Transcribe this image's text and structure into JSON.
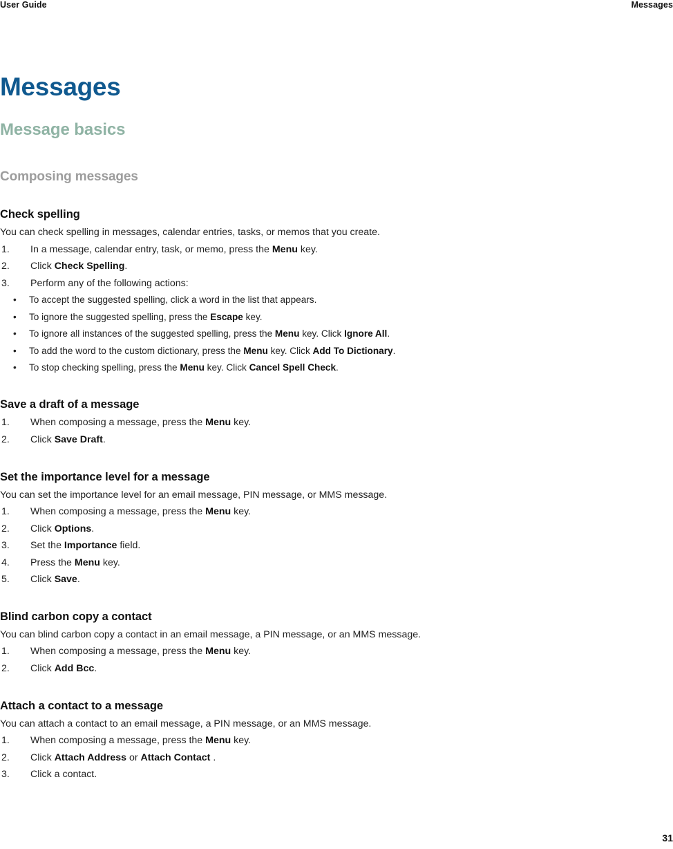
{
  "header": {
    "left": "User Guide",
    "right": "Messages"
  },
  "titles": {
    "h1": "Messages",
    "h2": "Message basics",
    "h3": "Composing messages"
  },
  "sections": [
    {
      "title": "Check spelling",
      "intro": "You can check spelling in messages, calendar entries, tasks, or memos that you create.",
      "steps": [
        {
          "num": "1.",
          "parts": [
            {
              "t": "In a message, calendar entry, task, or memo, press the ",
              "b": false
            },
            {
              "t": "Menu",
              "b": true
            },
            {
              "t": " key.",
              "b": false
            }
          ]
        },
        {
          "num": "2.",
          "parts": [
            {
              "t": "Click ",
              "b": false
            },
            {
              "t": "Check Spelling",
              "b": true
            },
            {
              "t": ".",
              "b": false
            }
          ]
        },
        {
          "num": "3.",
          "parts": [
            {
              "t": "Perform any of the following actions:",
              "b": false
            }
          ],
          "bullets": [
            [
              {
                "t": "To accept the suggested spelling, click a word in the list that appears.",
                "b": false
              }
            ],
            [
              {
                "t": "To ignore the suggested spelling, press the ",
                "b": false
              },
              {
                "t": "Escape",
                "b": true
              },
              {
                "t": " key.",
                "b": false
              }
            ],
            [
              {
                "t": "To ignore all instances of the suggested spelling, press the ",
                "b": false
              },
              {
                "t": "Menu",
                "b": true
              },
              {
                "t": " key. Click ",
                "b": false
              },
              {
                "t": "Ignore All",
                "b": true
              },
              {
                "t": ".",
                "b": false
              }
            ],
            [
              {
                "t": "To add the word to the custom dictionary, press the ",
                "b": false
              },
              {
                "t": "Menu",
                "b": true
              },
              {
                "t": " key. Click ",
                "b": false
              },
              {
                "t": "Add To Dictionary",
                "b": true
              },
              {
                "t": ".",
                "b": false
              }
            ],
            [
              {
                "t": "To stop checking spelling, press the ",
                "b": false
              },
              {
                "t": "Menu",
                "b": true
              },
              {
                "t": " key. Click ",
                "b": false
              },
              {
                "t": "Cancel Spell Check",
                "b": true
              },
              {
                "t": ".",
                "b": false
              }
            ]
          ]
        }
      ]
    },
    {
      "title": "Save a draft of a message",
      "intro": null,
      "steps": [
        {
          "num": "1.",
          "parts": [
            {
              "t": "When composing a message, press the ",
              "b": false
            },
            {
              "t": "Menu",
              "b": true
            },
            {
              "t": " key.",
              "b": false
            }
          ]
        },
        {
          "num": "2.",
          "parts": [
            {
              "t": "Click ",
              "b": false
            },
            {
              "t": "Save Draft",
              "b": true
            },
            {
              "t": ".",
              "b": false
            }
          ]
        }
      ]
    },
    {
      "title": "Set the importance level for a message",
      "intro": "You can set the importance level for an email message, PIN message, or MMS message.",
      "steps": [
        {
          "num": "1.",
          "parts": [
            {
              "t": "When composing a message, press the ",
              "b": false
            },
            {
              "t": "Menu",
              "b": true
            },
            {
              "t": " key.",
              "b": false
            }
          ]
        },
        {
          "num": "2.",
          "parts": [
            {
              "t": "Click ",
              "b": false
            },
            {
              "t": "Options",
              "b": true
            },
            {
              "t": ".",
              "b": false
            }
          ]
        },
        {
          "num": "3.",
          "parts": [
            {
              "t": "Set the ",
              "b": false
            },
            {
              "t": "Importance",
              "b": true
            },
            {
              "t": " field.",
              "b": false
            }
          ]
        },
        {
          "num": "4.",
          "parts": [
            {
              "t": "Press the ",
              "b": false
            },
            {
              "t": "Menu",
              "b": true
            },
            {
              "t": " key.",
              "b": false
            }
          ]
        },
        {
          "num": "5.",
          "parts": [
            {
              "t": "Click ",
              "b": false
            },
            {
              "t": "Save",
              "b": true
            },
            {
              "t": ".",
              "b": false
            }
          ]
        }
      ]
    },
    {
      "title": "Blind carbon copy a contact",
      "intro": "You can blind carbon copy a contact in an email message, a PIN message, or an MMS message.",
      "steps": [
        {
          "num": "1.",
          "parts": [
            {
              "t": "When composing a message, press the ",
              "b": false
            },
            {
              "t": "Menu",
              "b": true
            },
            {
              "t": " key.",
              "b": false
            }
          ]
        },
        {
          "num": "2.",
          "parts": [
            {
              "t": "Click ",
              "b": false
            },
            {
              "t": "Add Bcc",
              "b": true
            },
            {
              "t": ".",
              "b": false
            }
          ]
        }
      ]
    },
    {
      "title": "Attach a contact to a message",
      "intro": "You can attach a contact to an email message, a PIN message, or an MMS message.",
      "steps": [
        {
          "num": "1.",
          "parts": [
            {
              "t": "When composing a message, press the ",
              "b": false
            },
            {
              "t": "Menu",
              "b": true
            },
            {
              "t": " key.",
              "b": false
            }
          ]
        },
        {
          "num": "2.",
          "parts": [
            {
              "t": "Click ",
              "b": false
            },
            {
              "t": "Attach Address",
              "b": true
            },
            {
              "t": " or ",
              "b": false
            },
            {
              "t": "Attach Contact",
              "b": true
            },
            {
              "t": " .",
              "b": false
            }
          ]
        },
        {
          "num": "3.",
          "parts": [
            {
              "t": "Click a contact.",
              "b": false
            }
          ]
        }
      ]
    }
  ],
  "footer": {
    "page_number": "31"
  },
  "bullet_glyph": "•",
  "colors": {
    "title": "#10598f",
    "subtitle": "#8fb3a4",
    "group_title": "#9d9d9d",
    "body": "#222222"
  }
}
